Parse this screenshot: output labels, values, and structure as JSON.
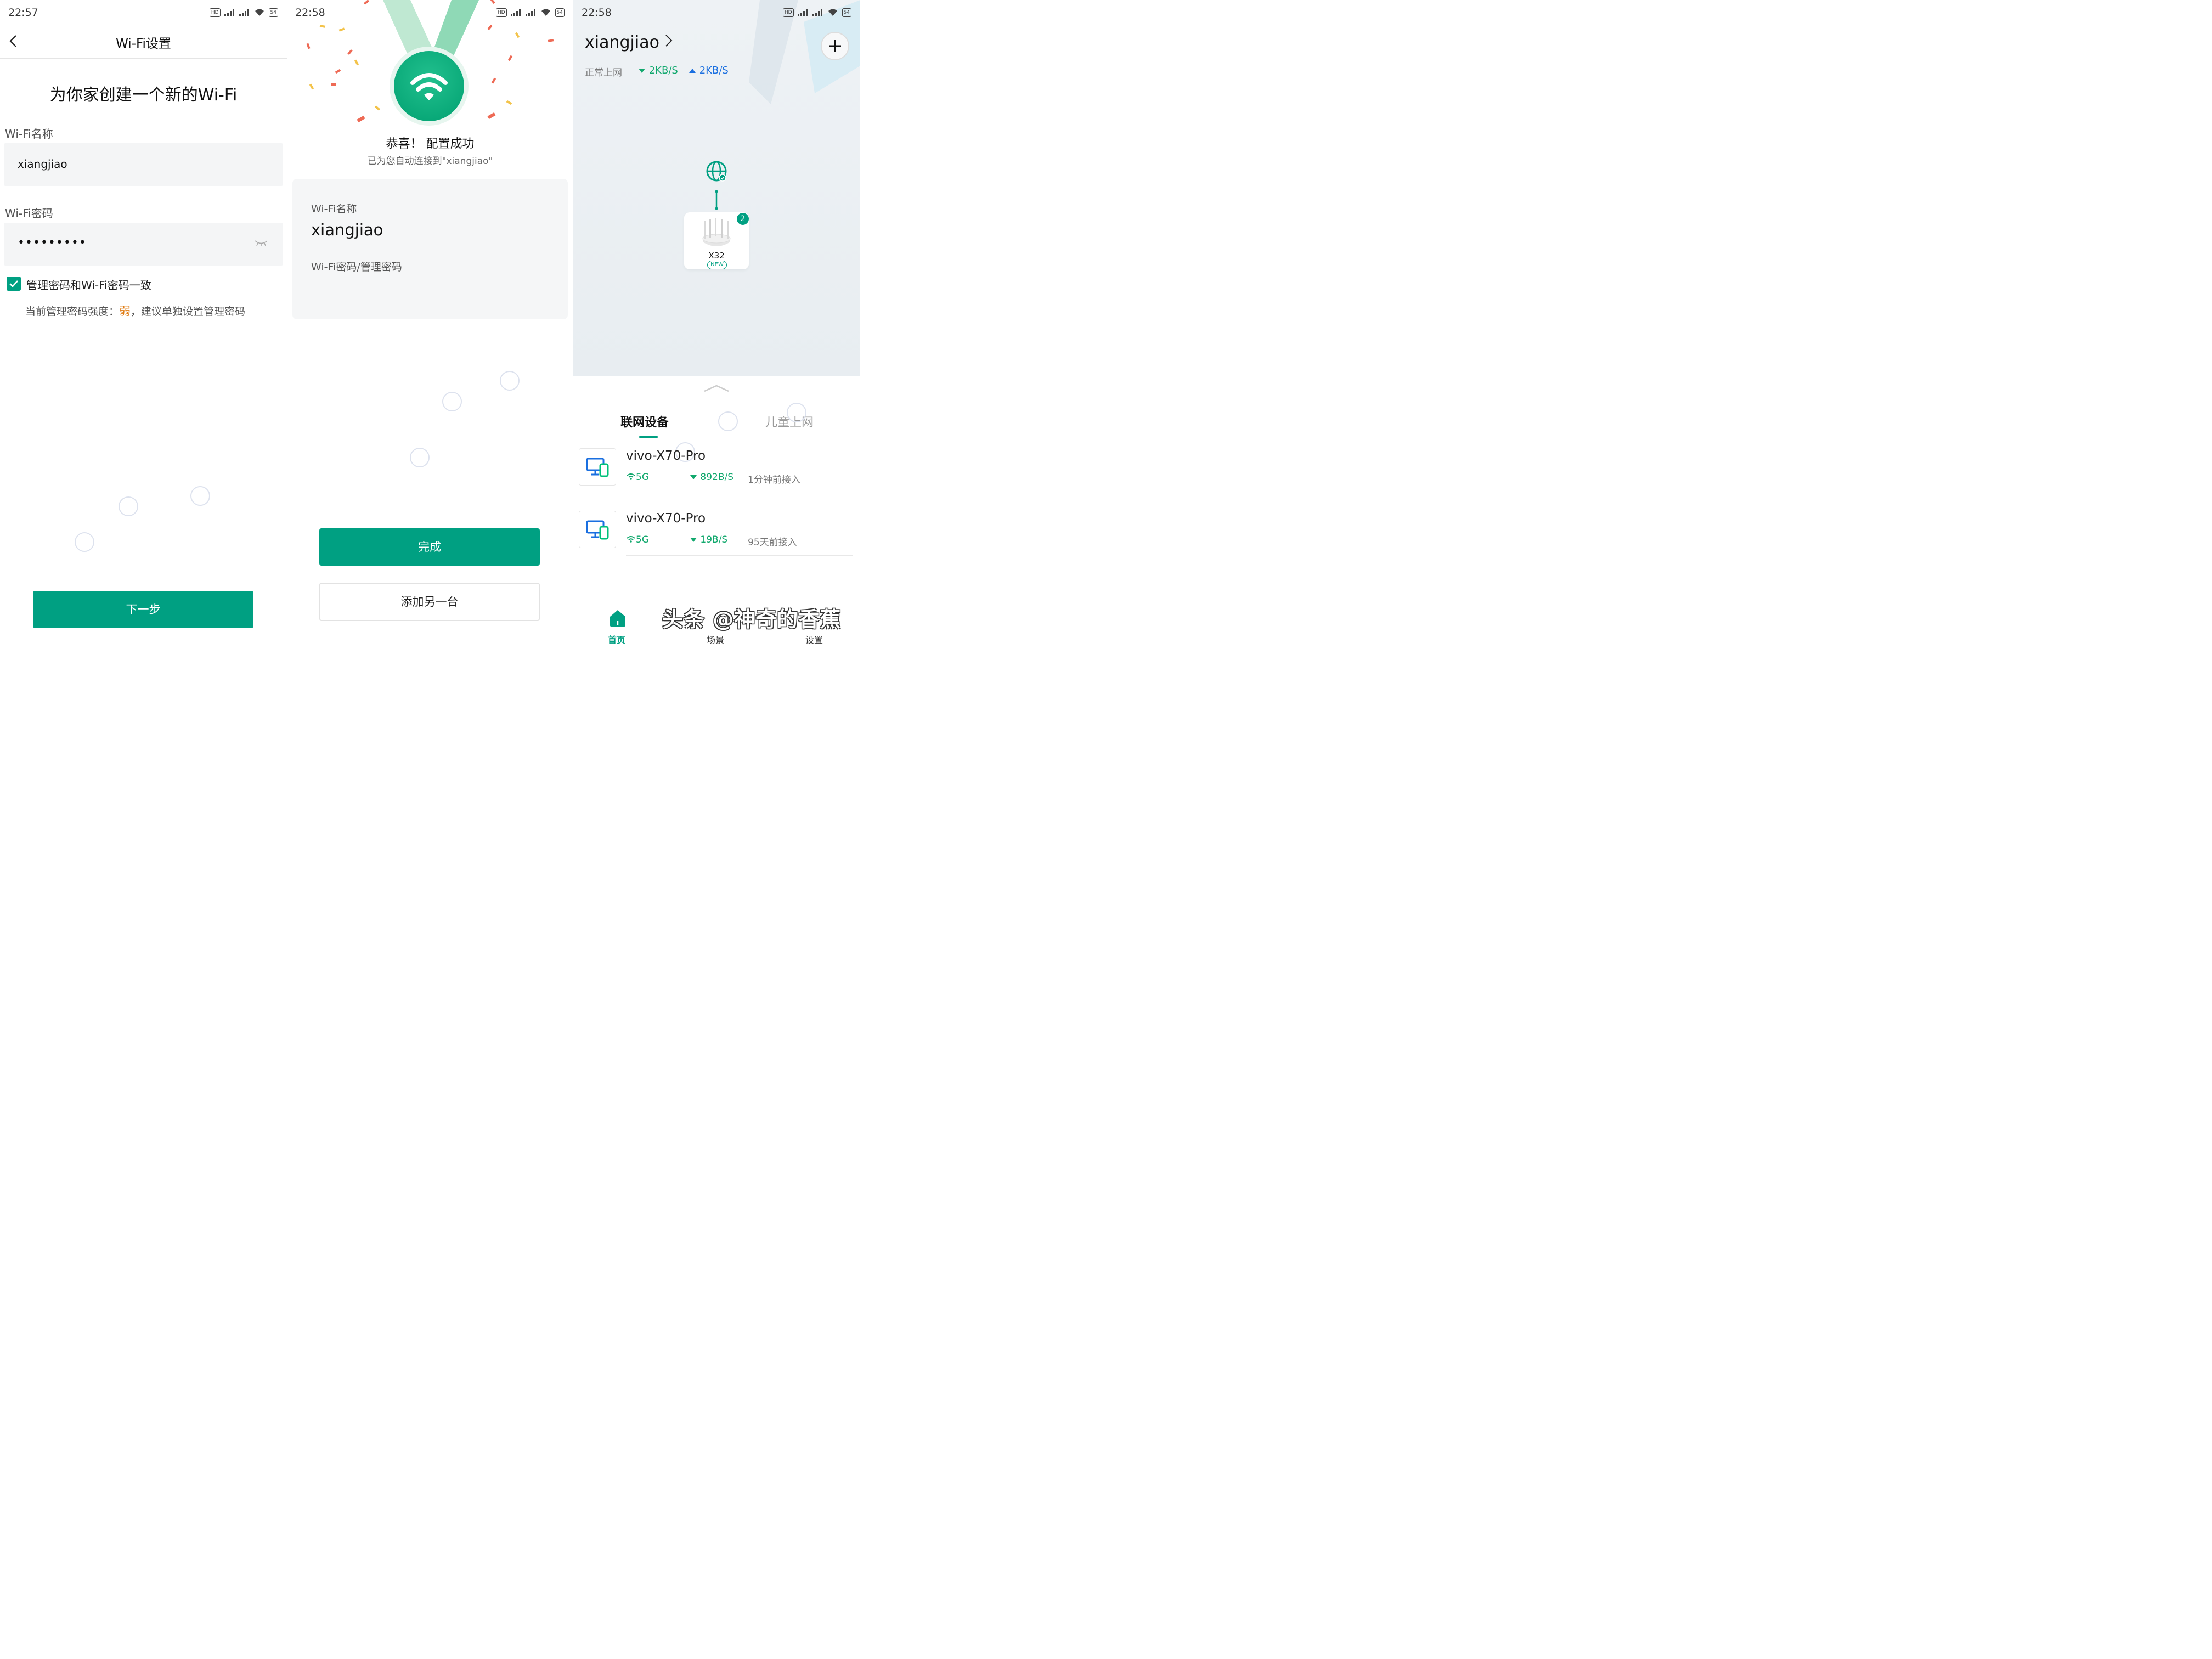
{
  "panel1": {
    "status": {
      "time": "22:57"
    },
    "header_title": "Wi-Fi设置",
    "heading": "为你家创建一个新的Wi-Fi",
    "name_label": "Wi-Fi名称",
    "name_value": "xiangjiao",
    "password_label": "Wi-Fi密码",
    "password_value": "•••••••••",
    "checkbox_label": "管理密码和Wi-Fi密码一致",
    "checkbox_checked": true,
    "strength_prefix": "当前管理密码强度：",
    "strength_value": "弱",
    "strength_suffix": "，建议单独设置管理密码",
    "next_button": "下一步"
  },
  "panel2": {
    "status": {
      "time": "22:58"
    },
    "success_title": "恭喜！ 配置成功",
    "auto_connected": "已为您自动连接到\"xiangjiao\"",
    "name_label": "Wi-Fi名称",
    "name_value": "xiangjiao",
    "password_label": "Wi-Fi密码/管理密码",
    "done_button": "完成",
    "add_another_button": "添加另一台"
  },
  "panel3": {
    "status": {
      "time": "22:58"
    },
    "network_name": "xiangjiao",
    "network_status": "正常上网",
    "download_speed": "2KB/S",
    "upload_speed": "2KB/S",
    "router": {
      "model": "X32",
      "tag": "NEW",
      "badge_count": "2"
    },
    "tabs": [
      "联网设备",
      "儿童上网"
    ],
    "devices": [
      {
        "name": "vivo-X70-Pro",
        "band": "5G",
        "speed": "892B/S",
        "connected": "1分钟前接入"
      },
      {
        "name": "vivo-X70-Pro",
        "band": "5G",
        "speed": "19B/S",
        "connected": "95天前接入"
      }
    ],
    "nav": [
      "首页",
      "场景",
      "设置"
    ],
    "watermark": "头条 @神奇的香蕉"
  },
  "colors": {
    "accent": "#00a082",
    "download": "#11a86d",
    "upload": "#1a6fe0",
    "warning": "#e07a10"
  }
}
